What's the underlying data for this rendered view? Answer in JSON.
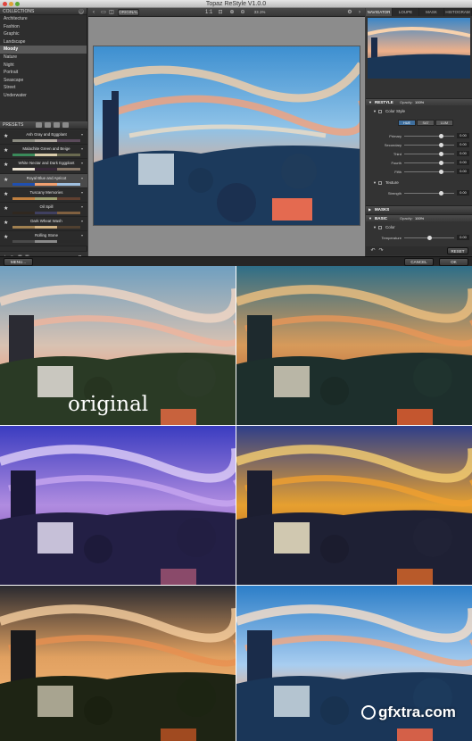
{
  "app": {
    "title": "Topaz ReStyle V1.0.0"
  },
  "left": {
    "collections_title": "COLLECTIONS",
    "collections": [
      "Architecture",
      "Fashion",
      "Graphic",
      "Landscape",
      "Moody",
      "Nature",
      "Night",
      "Portrait",
      "Seascape",
      "Street",
      "Underwater"
    ],
    "selected_collection": "Moody",
    "presets_title": "PRESETS",
    "presets": [
      {
        "name": "Ash Gray and Eggplant"
      },
      {
        "name": "Malachite Green and Beige"
      },
      {
        "name": "White Nectar and Dark Eggplant"
      },
      {
        "name": "Royal Blue and Apricot",
        "selected": true
      },
      {
        "name": "Tuscany Memories"
      },
      {
        "name": "Oil Spill"
      },
      {
        "name": "Dark Wheat Wash"
      },
      {
        "name": "Rolling Stone"
      }
    ]
  },
  "toolbar": {
    "original_label": "ORIGINAL",
    "ratio_label": "1:1",
    "zoom_label": "33.1%"
  },
  "right": {
    "tabs": [
      "NAVIGATOR",
      "LOUPE",
      "MASK",
      "HISTOGRAM"
    ],
    "active_tab": "NAVIGATOR",
    "restyle": {
      "title": "RESTYLE",
      "opacity_label": "Opacity:",
      "opacity": "100%"
    },
    "color_style": {
      "title": "Color Style",
      "modes": [
        "HUE",
        "SAT",
        "LUM"
      ],
      "active_mode": "HUE"
    },
    "color_sliders": [
      {
        "label": "Primary",
        "value": "0.00"
      },
      {
        "label": "Secondary",
        "value": "0.00"
      },
      {
        "label": "Third",
        "value": "0.00"
      },
      {
        "label": "Fourth",
        "value": "0.00"
      },
      {
        "label": "Fifth",
        "value": "0.00"
      }
    ],
    "texture": {
      "title": "Texture",
      "slider_label": "Strength",
      "value": "0.00"
    },
    "masks": {
      "title": "MASKS"
    },
    "basic": {
      "title": "BASIC",
      "opacity_label": "Opacity:",
      "opacity": "100%"
    },
    "color": {
      "title": "Color",
      "slider_label": "Temperature",
      "value": "0.00"
    },
    "reset_label": "RESET"
  },
  "bottom": {
    "menu_label": "MENU...",
    "cancel_label": "CANCEL",
    "ok_label": "OK"
  },
  "comparison": {
    "original_label": "original"
  },
  "watermark": {
    "text": "gfxtra.com"
  }
}
